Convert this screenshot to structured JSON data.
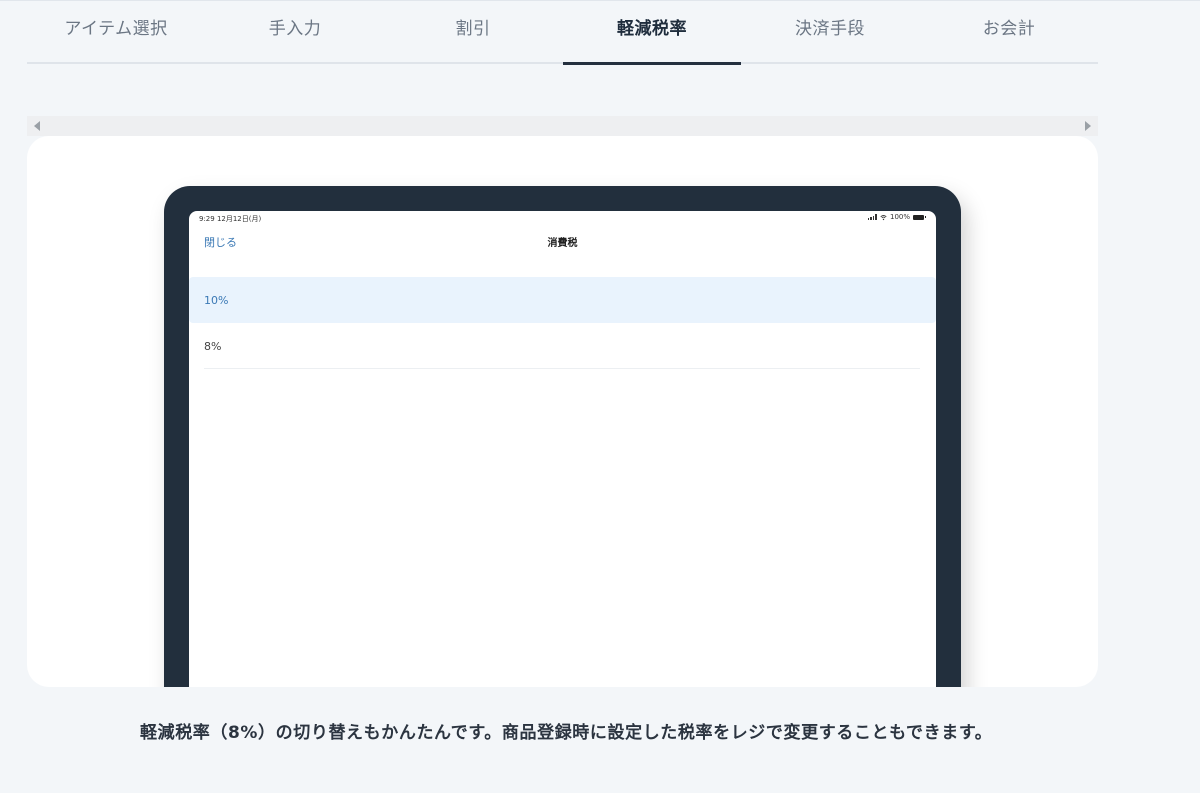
{
  "tabs": [
    {
      "label": "アイテム選択",
      "active": false
    },
    {
      "label": "手入力",
      "active": false
    },
    {
      "label": "割引",
      "active": false
    },
    {
      "label": "軽減税率",
      "active": true
    },
    {
      "label": "決済手段",
      "active": false
    },
    {
      "label": "お会計",
      "active": false
    }
  ],
  "colors": {
    "page_bg": "#f3f6f9",
    "tablet_frame": "#222f3d",
    "accent_blue": "#3b79b5",
    "selected_row_bg": "#e9f3fd",
    "active_tab_underline": "#24303f"
  },
  "device": {
    "status_time": "9:29  12月12日(月)",
    "battery_text": "100%",
    "icons": [
      "signal-icon",
      "wifi-icon",
      "battery-icon"
    ],
    "nav": {
      "close_label": "閉じる",
      "title": "消費税"
    },
    "options": [
      {
        "label": "10%",
        "selected": true
      },
      {
        "label": "8%",
        "selected": false
      }
    ]
  },
  "scroll_icons": [
    "scroll-left-icon",
    "scroll-right-icon"
  ],
  "caption": "軽減税率（8%）の切り替えもかんたんです。商品登録時に設定した税率をレジで変更することもできます。"
}
